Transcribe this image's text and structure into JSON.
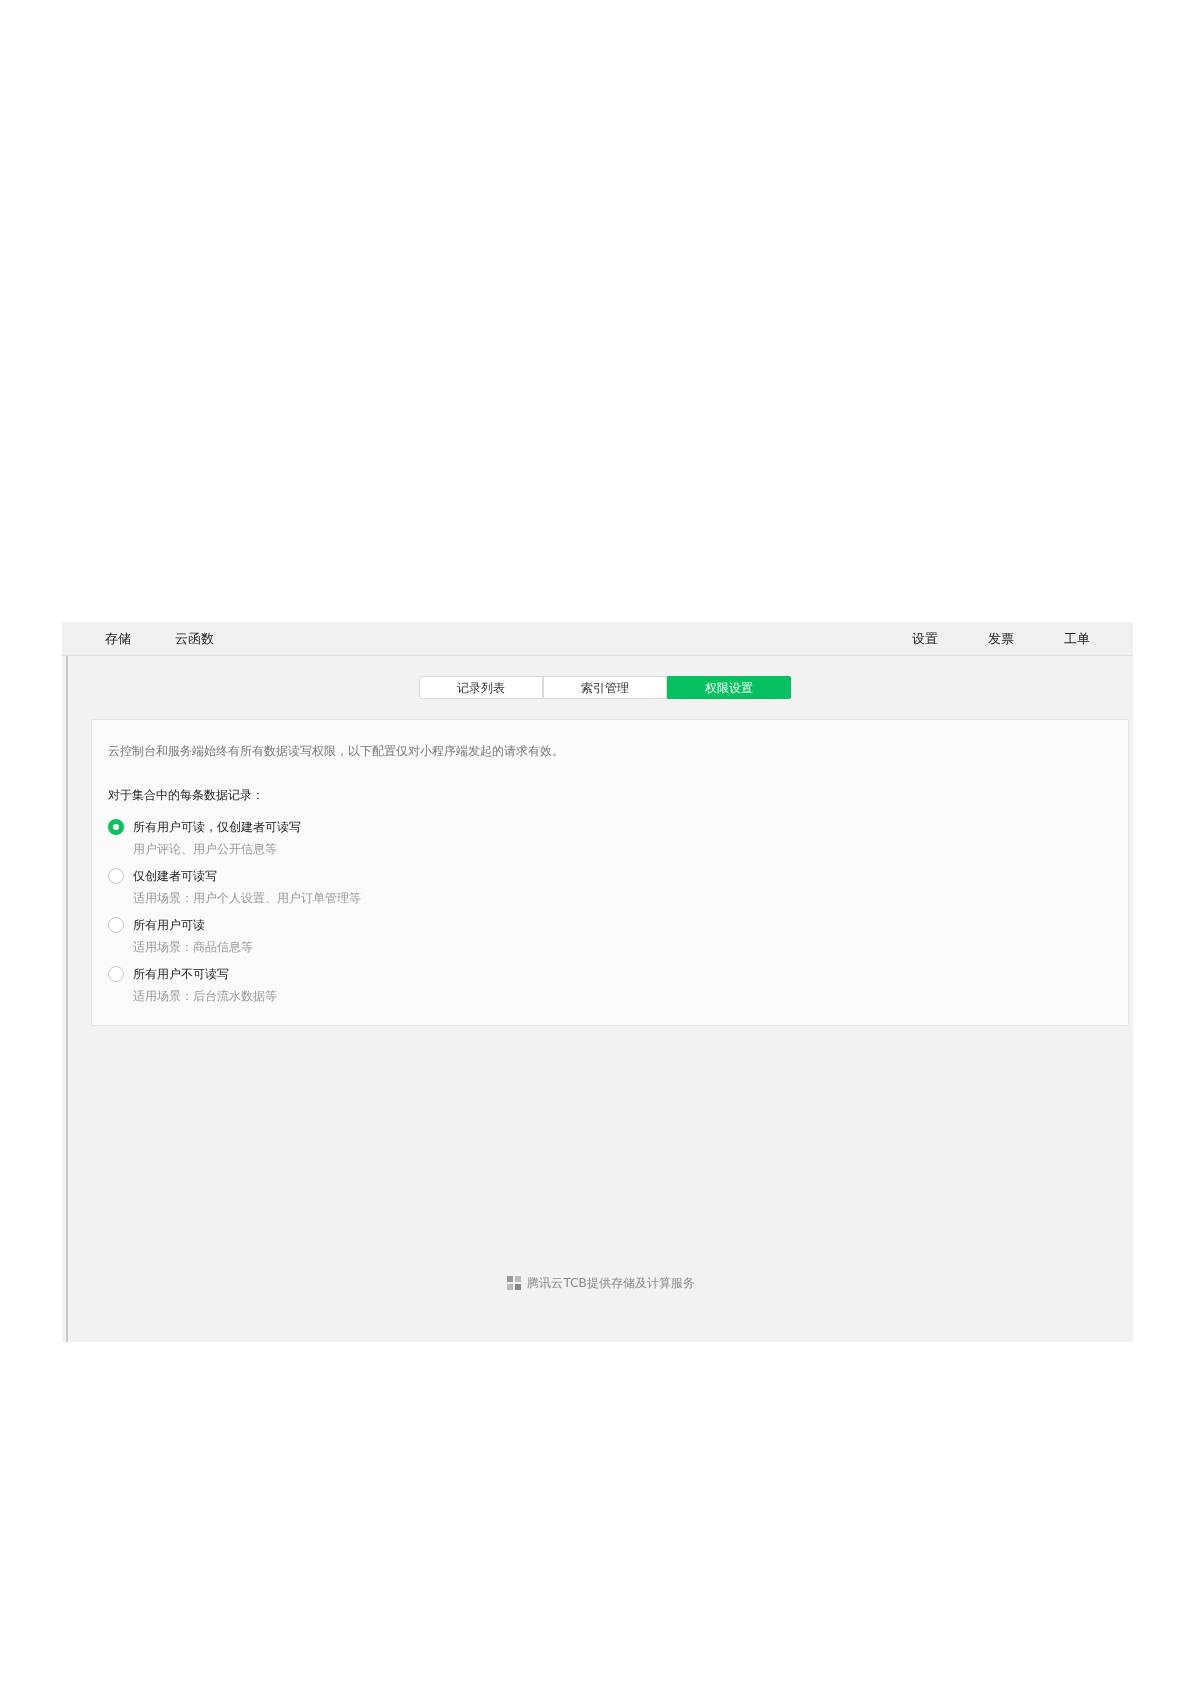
{
  "nav": {
    "left": [
      {
        "label": "存储"
      },
      {
        "label": "云函数"
      }
    ],
    "right": [
      {
        "label": "设置"
      },
      {
        "label": "发票"
      },
      {
        "label": "工单"
      }
    ]
  },
  "tabs": [
    {
      "label": "记录列表",
      "selected": false
    },
    {
      "label": "索引管理",
      "selected": false
    },
    {
      "label": "权限设置",
      "selected": true
    }
  ],
  "notice": "云控制台和服务端始终有所有数据读写权限，以下配置仅对小程序端发起的请求有效。",
  "question": "对于集合中的每条数据记录：",
  "options": [
    {
      "label": "所有用户可读，仅创建者可读写",
      "hint": "用户评论、用户公开信息等",
      "selected": true
    },
    {
      "label": "仅创建者可读写",
      "hint": "适用场景：用户个人设置、用户订单管理等",
      "selected": false
    },
    {
      "label": "所有用户可读",
      "hint": "适用场景：商品信息等",
      "selected": false
    },
    {
      "label": "所有用户不可读写",
      "hint": "适用场景：后台流水数据等",
      "selected": false
    }
  ],
  "footer": "腾讯云TCB提供存储及计算服务"
}
